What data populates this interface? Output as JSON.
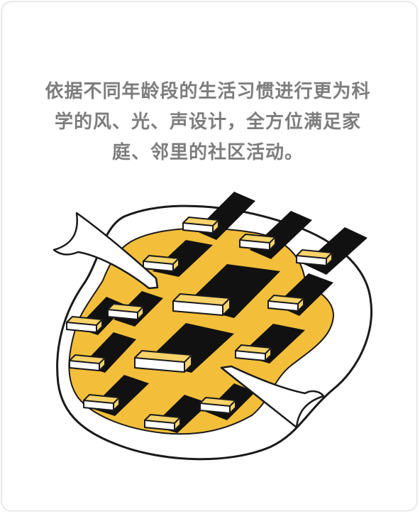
{
  "caption": {
    "lines": [
      "依据不同年龄段的生活习惯进行更为科",
      "学的风、光、声设计，全方位满足家",
      "庭、邻里的社区活动。"
    ]
  },
  "colors": {
    "accent_yellow": "#f3bf3a",
    "block_yellow": "#f7d36a",
    "ink": "#1a1a1a",
    "caption_gray": "#7d7d7d"
  }
}
